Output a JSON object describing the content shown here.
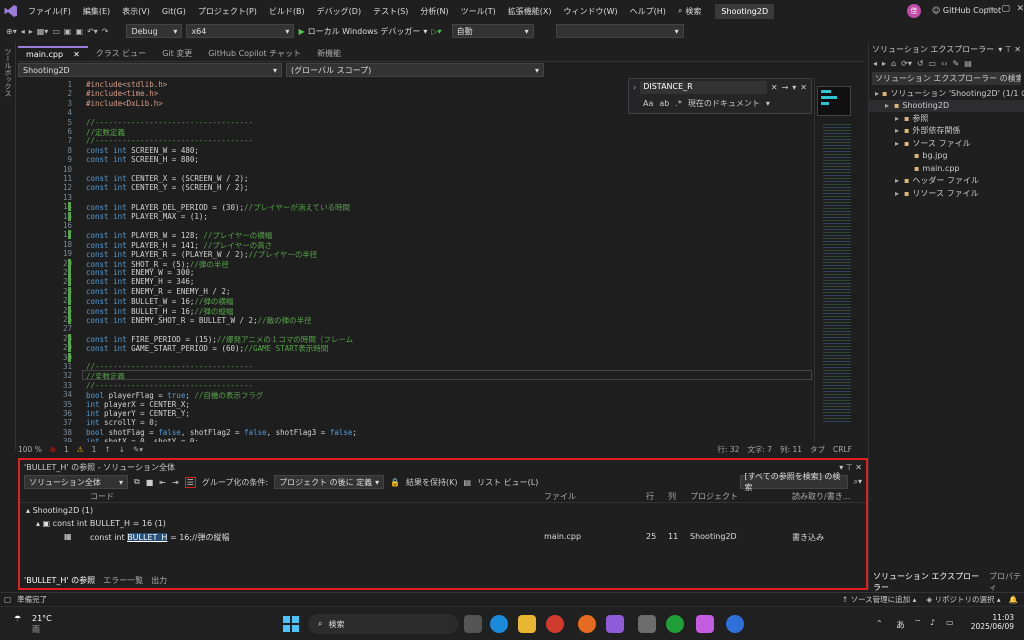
{
  "menu": [
    "ファイル(F)",
    "編集(E)",
    "表示(V)",
    "Git(G)",
    "プロジェクト(P)",
    "ビルド(B)",
    "デバッグ(D)",
    "テスト(S)",
    "分析(N)",
    "ツール(T)",
    "拡張機能(X)",
    "ウィンドウ(W)",
    "ヘルプ(H)"
  ],
  "search_label": "検索",
  "window_title": "Shooting2D",
  "avatar_letter": "佳",
  "copilot_label": "GitHub Copilot",
  "toolbar": {
    "config": "Debug",
    "platform": "x64",
    "run": "ローカル Windows デバッガー",
    "auto": "自動"
  },
  "left_tool_label": "ツールボックス",
  "tabs": [
    "main.cpp",
    "クラス ビュー",
    "Git 変更",
    "GitHub Copilot チャット",
    "新機能"
  ],
  "nav": {
    "project": "Shooting2D",
    "scope": "(グローバル スコープ)"
  },
  "find": {
    "query": "DISTANCE_R",
    "aa": "Aa",
    "ab": "ab",
    "scope": "現在のドキュメント"
  },
  "lines": [
    {
      "n": "1",
      "t": "#include<stdlib.h>"
    },
    {
      "n": "2",
      "t": "#include<time.h>"
    },
    {
      "n": "3",
      "t": "#include<DxLib.h>"
    },
    {
      "n": "4",
      "t": ""
    },
    {
      "n": "5",
      "t": "//-----------------------------------"
    },
    {
      "n": "6",
      "t": "//定数定義"
    },
    {
      "n": "7",
      "t": "//-----------------------------------"
    },
    {
      "n": "8",
      "t": "const int SCREEN_W = 480;"
    },
    {
      "n": "9",
      "t": "const int SCREEN_H = 880;"
    },
    {
      "n": "10",
      "t": ""
    },
    {
      "n": "11",
      "t": "const int CENTER_X = (SCREEN_W / 2);"
    },
    {
      "n": "12",
      "t": "const int CENTER_Y = (SCREEN_H / 2);"
    },
    {
      "n": "13",
      "t": ""
    },
    {
      "n": "14",
      "t": "const int PLAYER_DEL_PERIOD = (30);//プレイヤーが消えている時間"
    },
    {
      "n": "15",
      "t": "const int PLAYER_MAX = (1);"
    },
    {
      "n": "16",
      "t": ""
    },
    {
      "n": "17",
      "t": "const int PLAYER_W = 128; //プレイヤーの横幅"
    },
    {
      "n": "18",
      "t": "const int PLAYER_H = 141; //プレイヤーの高さ"
    },
    {
      "n": "19",
      "t": "const int PLAYER_R = (PLAYER_W / 2);//プレイヤーの半径"
    },
    {
      "n": "20",
      "t": "const int SHOT_R = (5);//弾の半径"
    },
    {
      "n": "21",
      "t": "const int ENEMY_W = 300;"
    },
    {
      "n": "22",
      "t": "const int ENEMY_H = 346;"
    },
    {
      "n": "23",
      "t": "const int ENEMY_R = ENEMY_H / 2;"
    },
    {
      "n": "24",
      "t": "const int BULLET_W = 16;//弾の横幅"
    },
    {
      "n": "25",
      "t": "const int BULLET_H = 16;//弾の縦幅"
    },
    {
      "n": "26",
      "t": "const int ENEMY_SHOT_R = BULLET_W / 2;//敵の弾の半径"
    },
    {
      "n": "27",
      "t": ""
    },
    {
      "n": "28",
      "t": "const int FIRE_PERIOD = (15);//爆発アニメの１コマの時間（フレーム"
    },
    {
      "n": "29",
      "t": "const int GAME_START_PERIOD = (60);//GAME START表示時間"
    },
    {
      "n": "30",
      "t": ""
    },
    {
      "n": "31",
      "t": "//-----------------------------------"
    },
    {
      "n": "32",
      "t": "//変数定義"
    },
    {
      "n": "33",
      "t": "//-----------------------------------"
    },
    {
      "n": "34",
      "t": "bool playerFlag = true; //自機の表示フラグ"
    },
    {
      "n": "35",
      "t": "int playerX = CENTER_X;"
    },
    {
      "n": "36",
      "t": "int playerY = CENTER_Y;"
    },
    {
      "n": "37",
      "t": "int scrollY = 0;"
    },
    {
      "n": "38",
      "t": "bool shotFlag = false, shotFlag2 = false, shotFlag3 = false;"
    },
    {
      "n": "39",
      "t": "int shotX = 0, shotY = 0;"
    }
  ],
  "status_line": {
    "zoom": "100 %",
    "errors": "1",
    "warnings": "1",
    "line": "行: 32",
    "char": "文字: 7",
    "col": "列: 11",
    "tab": "タブ",
    "eol": "CRLF"
  },
  "refs": {
    "title": "'BULLET_H' の参照 - ソリューション全体",
    "scope": "ソリューション全体",
    "group_label": "グループ化の条件:",
    "group_value": "プロジェクト の後に 定義",
    "keep": "結果を保持(K)",
    "listview": "リスト ビュー(L)",
    "search_placeholder": "[すべての参照を検索] の検索",
    "headers": {
      "code": "コード",
      "file": "ファイル",
      "line": "行",
      "col": "列",
      "project": "プロジェクト",
      "rw": "読み取り/書き..."
    },
    "group1": "Shooting2D  (1)",
    "group2": "const int BULLET_H = 16  (1)",
    "row": {
      "pre": "const int ",
      "hit": "BULLET_H",
      "post": " = 16;//弾の縦幅",
      "file": "main.cpp",
      "line": "25",
      "col": "11",
      "project": "Shooting2D",
      "rw": "書き込み"
    },
    "bottom_tabs": [
      "'BULLET_H' の参照",
      "エラー一覧",
      "出力"
    ]
  },
  "solution": {
    "title": "ソリューション エクスプローラー",
    "search": "ソリューション エクスプローラー の検索 (C",
    "items": [
      {
        "label": "ソリューション 'Shooting2D' (1/1 のプロジ",
        "indent": 0
      },
      {
        "label": "Shooting2D",
        "indent": 1
      },
      {
        "label": "参照",
        "indent": 2
      },
      {
        "label": "外部依存関係",
        "indent": 2
      },
      {
        "label": "ソース ファイル",
        "indent": 2
      },
      {
        "label": "bg.jpg",
        "indent": 3
      },
      {
        "label": "main.cpp",
        "indent": 3
      },
      {
        "label": "ヘッダー ファイル",
        "indent": 2
      },
      {
        "label": "リソース ファイル",
        "indent": 2
      }
    ],
    "bottom_tabs": [
      "ソリューション エクスプローラー",
      "プロパティ"
    ]
  },
  "statusbar": {
    "ready": "準備完了",
    "source": "ソース管理に追加",
    "repo": "リポジトリの選択"
  },
  "taskbar": {
    "temp": "21°C",
    "weather": "雨",
    "search": "検索",
    "time": "11:03",
    "date": "2025/06/09",
    "ime": "あ"
  },
  "colors": {
    "accent": "#9b7cd9",
    "highlight_border": "#e02020",
    "error": "#e51400"
  }
}
